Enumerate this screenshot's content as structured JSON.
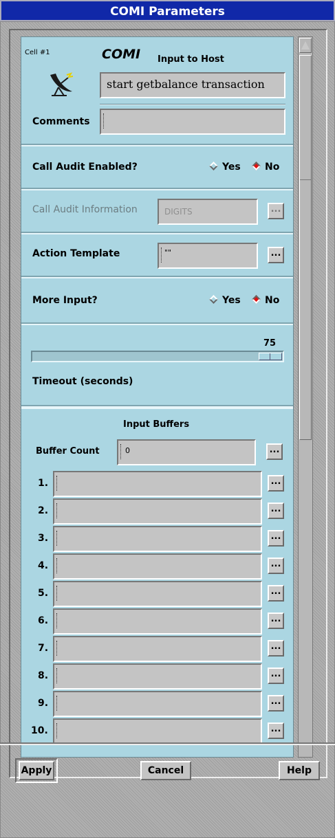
{
  "window": {
    "title": "COMI Parameters"
  },
  "header": {
    "cell_label": "Cell #1",
    "app_name": "COMI",
    "input_to_host_label": "Input to Host",
    "input_to_host_value": "start getbalance transaction",
    "icon": "satellite-dish-icon",
    "comments_label": "Comments",
    "comments_value": ""
  },
  "call_audit": {
    "label": "Call Audit Enabled?",
    "options": [
      "Yes",
      "No"
    ],
    "selected": "No"
  },
  "call_audit_info": {
    "label": "Call Audit Information",
    "value": "DIGITS",
    "button": "..."
  },
  "action_template": {
    "label": "Action Template",
    "value": "\"\"",
    "button": "..."
  },
  "more_input": {
    "label": "More Input?",
    "options": [
      "Yes",
      "No"
    ],
    "selected": "No"
  },
  "timeout": {
    "label": "Timeout (seconds)",
    "value": "75"
  },
  "input_buffers": {
    "title": "Input Buffers",
    "buffer_count_label": "Buffer Count",
    "buffer_count_value": "0",
    "button": "...",
    "rows": [
      {
        "label": "1.",
        "value": ""
      },
      {
        "label": "2.",
        "value": ""
      },
      {
        "label": "3.",
        "value": ""
      },
      {
        "label": "4.",
        "value": ""
      },
      {
        "label": "5.",
        "value": ""
      },
      {
        "label": "6.",
        "value": ""
      },
      {
        "label": "7.",
        "value": ""
      },
      {
        "label": "8.",
        "value": ""
      },
      {
        "label": "9.",
        "value": ""
      },
      {
        "label": "10.",
        "value": ""
      }
    ]
  },
  "buttons": {
    "apply": "Apply",
    "cancel": "Cancel",
    "help": "Help"
  },
  "colors": {
    "title_bar": "#1028a8",
    "panel": "#abd6e2",
    "radio_selected": "#e01010",
    "icon_accent": "#e8d000"
  }
}
